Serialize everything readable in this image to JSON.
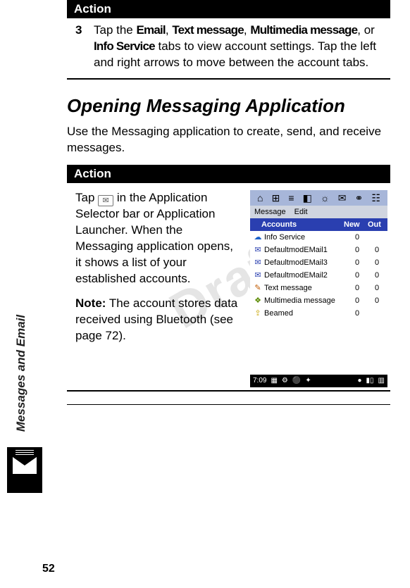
{
  "page_number": "52",
  "side_label": "Messages and Email",
  "watermark": "Draft",
  "first_action": {
    "header": "Action",
    "step_number": "3",
    "text_parts": {
      "p1": "Tap the ",
      "b1": "Email",
      "p2": ", ",
      "b2": "Text message",
      "p3": ", ",
      "b3": "Multimedia message",
      "p4": ", or ",
      "b4": "Info Service",
      "p5": " tabs to view account settings. Tap the left and right arrows to move between the account tabs."
    }
  },
  "section_title": "Opening Messaging Application",
  "section_lead": "Use the Messaging application to create, send, and receive messages.",
  "second_action": {
    "header": "Action",
    "p1a": "Tap ",
    "p1b": " in the Application Selector bar or Application Launcher. When the Messaging application opens, it shows a list of your established accounts.",
    "note_label": "Note:",
    "note_text": " The account stores data received using Bluetooth (see page 72)."
  },
  "device": {
    "top_icons": [
      "⌂",
      "⊞",
      "≡",
      "◧",
      "☼",
      "✉",
      "⚭",
      "☷"
    ],
    "menu": [
      "Message",
      "Edit"
    ],
    "columns": {
      "c1": "Accounts",
      "c2": "New",
      "c3": "Out"
    },
    "rows": [
      {
        "icon": "☁",
        "cls": "ic-info",
        "name": "Info Service",
        "new": "0",
        "out": ""
      },
      {
        "icon": "✉",
        "cls": "ic-mail",
        "name": "DefaultmodEMail1",
        "new": "0",
        "out": "0"
      },
      {
        "icon": "✉",
        "cls": "ic-mail",
        "name": "DefaultmodEMail3",
        "new": "0",
        "out": "0"
      },
      {
        "icon": "✉",
        "cls": "ic-mail",
        "name": "DefaultmodEMail2",
        "new": "0",
        "out": "0"
      },
      {
        "icon": "✎",
        "cls": "ic-txt",
        "name": "Text message",
        "new": "0",
        "out": "0"
      },
      {
        "icon": "❖",
        "cls": "ic-mms",
        "name": "Multimedia message",
        "new": "0",
        "out": "0"
      },
      {
        "icon": "⇪",
        "cls": "ic-beam",
        "name": "Beamed",
        "new": "0",
        "out": ""
      }
    ],
    "status": {
      "time": "7:09",
      "left_icons": [
        "▦",
        "⚙",
        "⚫",
        "✦"
      ],
      "right_icons": [
        "●",
        "▮▯",
        "▥"
      ]
    }
  }
}
